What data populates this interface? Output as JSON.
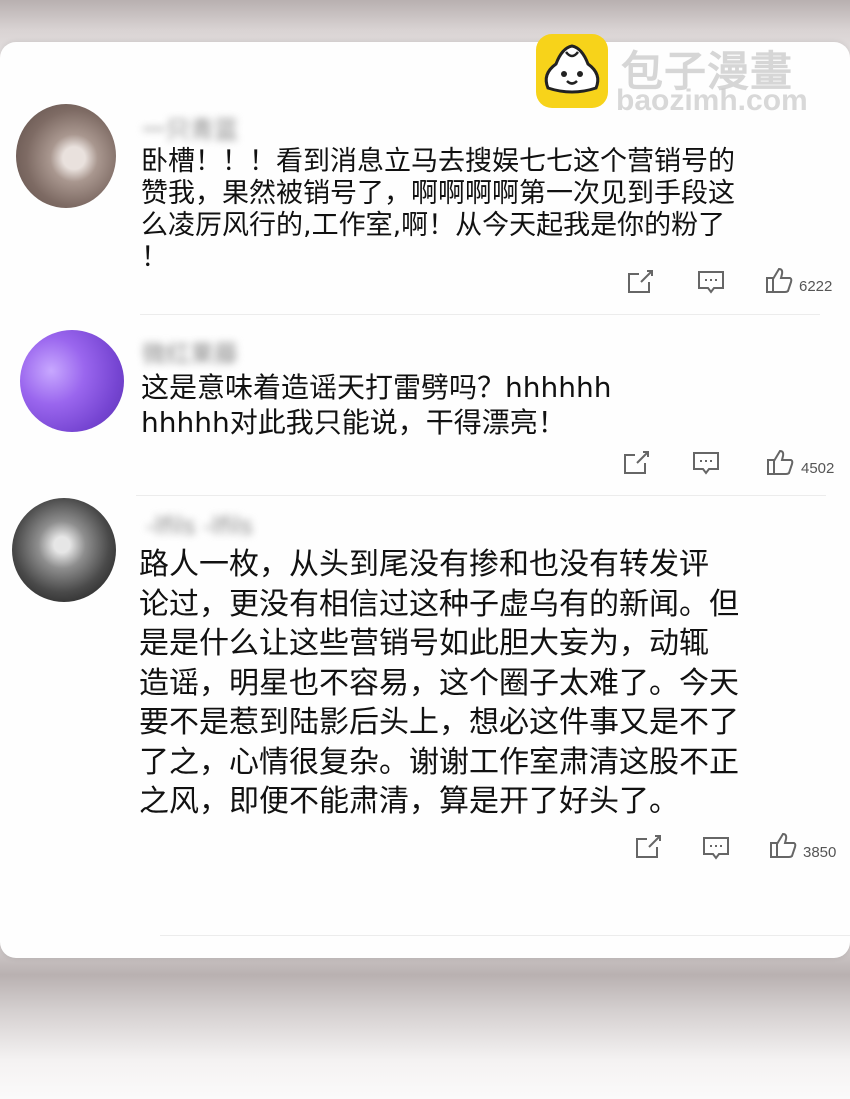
{
  "watermark": {
    "name": "包子漫畫",
    "url": "baozimh.com",
    "icon": "bun-face-icon"
  },
  "comments": [
    {
      "username": "一只青蓝",
      "text": "卧槽！！！看到消息立马去搜娱七七这个营销号的\n赞我，果然被销号了，啊啊啊啊第一次见到手段这\n么凌厉风行的,工作室,啊！从今天起我是你的粉了\n！",
      "likes": "6222"
    },
    {
      "username": "微红果藤",
      "text": "这是意味着造谣天打雷劈吗？hhhhhh\nhhhhh对此我只能说，干得漂亮！",
      "likes": "4502"
    },
    {
      "username": "-lfils -lfils",
      "text": " 路人一枚，从头到尾没有掺和也没有转发评\n论过，更没有相信过这种子虚乌有的新闻。但\n是是什么让这些营销号如此胆大妄为，动辄\n造谣，明星也不容易，这个圈子太难了。今天\n要不是惹到陆影后头上，想必这件事又是不了\n了之，心情很复杂。谢谢工作室肃清这股不正\n之风，即便不能肃清，算是开了好头了。",
      "likes": "3850"
    }
  ],
  "actions": {
    "share_icon": "share-icon",
    "reply_icon": "comment-icon",
    "like_icon": "thumbs-up-icon"
  }
}
